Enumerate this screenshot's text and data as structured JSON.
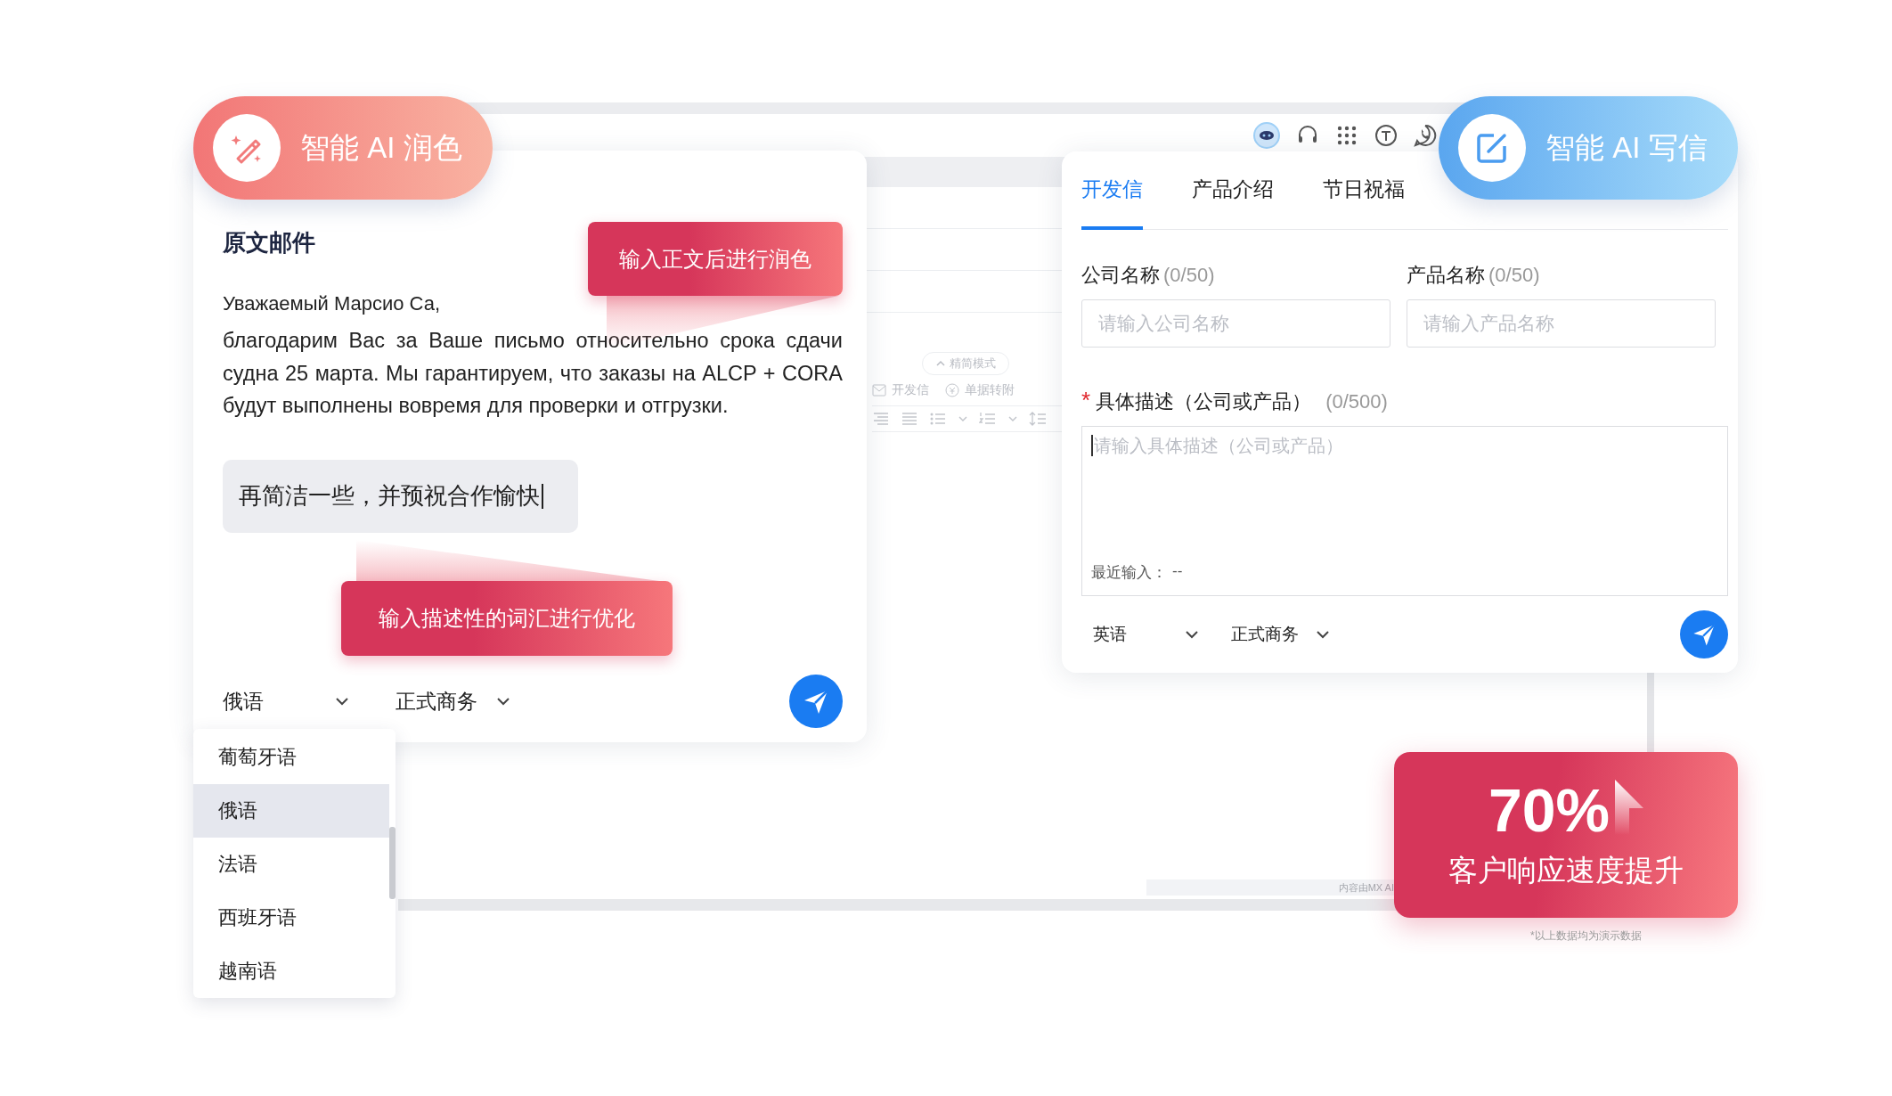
{
  "background_window": {
    "mode_toggle": "精简模式",
    "toolbar_items": [
      "开发信",
      "单据转附"
    ],
    "footer_note": "内容由MX AI"
  },
  "polish_card": {
    "badge": "智能 AI 润色",
    "title": "原文邮件",
    "greeting": "Уважаемый Марсио Са,",
    "body": "благодарим Вас за Ваше письмо относительно срока сдачи судна 25 марта. Мы гарантируем, что заказы на ALCP + CORA будут выполнены вовремя для проверки и отгрузки.",
    "prompt": "再简洁一些，并预祝合作愉快",
    "callouts": [
      "输入正文后进行润色",
      "输入描述性的词汇进行优化"
    ],
    "language": "俄语",
    "tone": "正式商务",
    "language_menu": [
      {
        "label": "葡萄牙语",
        "selected": false
      },
      {
        "label": "俄语",
        "selected": true
      },
      {
        "label": "法语",
        "selected": false
      },
      {
        "label": "西班牙语",
        "selected": false
      },
      {
        "label": "越南语",
        "selected": false
      }
    ]
  },
  "writer_card": {
    "badge": "智能 AI 写信",
    "tabs": [
      {
        "label": "开发信",
        "selected": true
      },
      {
        "label": "产品介绍",
        "selected": false
      },
      {
        "label": "节日祝福",
        "selected": false
      }
    ],
    "fields": [
      {
        "label": "公司名称",
        "counter": "(0/50)",
        "placeholder": "请输入公司名称"
      },
      {
        "label": "产品名称",
        "counter": "(0/50)",
        "placeholder": "请输入产品名称"
      }
    ],
    "description": {
      "label": "具体描述（公司或产品）",
      "required_mark": "*",
      "counter": "(0/500)",
      "placeholder": "请输入具体描述（公司或产品）",
      "recent_label": "最近输入：",
      "recent_value": "--"
    },
    "language": "英语",
    "tone": "正式商务"
  },
  "stat": {
    "value": "70%",
    "caption": "客户响应速度提升"
  },
  "footnote": "*以上数据均为演示数据"
}
